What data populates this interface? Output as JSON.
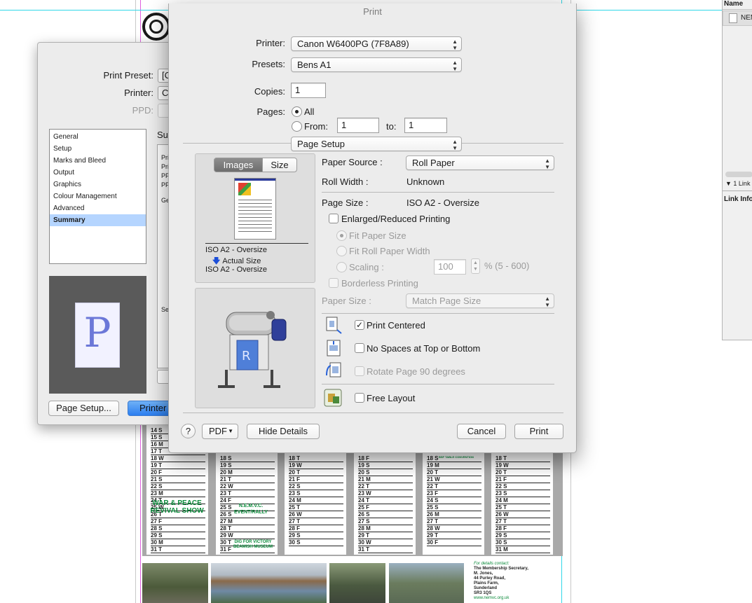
{
  "links_panel": {
    "name_header": "Name",
    "file_row": "NEM",
    "link_count": "1 Link",
    "link_info": "Link Info"
  },
  "calendar": {
    "columns": [
      [
        "14 S",
        "15 S",
        "16 M",
        "17 T",
        "18 W",
        "19 T",
        "20 F",
        "21 S",
        "22 S",
        "23 M",
        "24 T",
        "25 W",
        "26 T",
        "27 F",
        "28 S",
        "29 S",
        "30 M",
        "31 T"
      ],
      [
        "",
        "",
        "",
        "",
        "18 S",
        "19 S",
        "20 M",
        "21 T",
        "22 W",
        "23 T",
        "24 F",
        "25 S",
        "26 S",
        "27 M",
        "28 T",
        "29 W",
        "30 T",
        "31 F"
      ],
      [
        "",
        "",
        "",
        "",
        "18 T",
        "19 W",
        "20 T",
        "21 F",
        "22 S",
        "23 S",
        "24 M",
        "25 T",
        "26 W",
        "27 T",
        "28 F",
        "29 S",
        "30 S",
        ""
      ],
      [
        "",
        "",
        "",
        "",
        "18 F",
        "19 S",
        "20 S",
        "21 M",
        "22 T",
        "23 W",
        "24 T",
        "25 F",
        "26 S",
        "27 S",
        "28 M",
        "29 T",
        "30 W",
        "31 T"
      ],
      [
        "",
        "",
        "",
        "",
        "18 S",
        "19 M",
        "20 T",
        "21 W",
        "22 T",
        "23 F",
        "24 S",
        "25 S",
        "26 M",
        "27 T",
        "28 W",
        "29 T",
        "30 F",
        ""
      ],
      [
        "",
        "",
        "",
        "",
        "18 T",
        "19 W",
        "20 T",
        "21 F",
        "22 S",
        "23 S",
        "24 M",
        "25 T",
        "26 W",
        "27 T",
        "28 F",
        "29 S",
        "30 S",
        "31 M"
      ]
    ],
    "events": {
      "war_peace": "WAR & PEACE REVIVAL SHOW",
      "nemvc": "N.E.M.V.C. EVENT/RALLY",
      "dig": "DIG FOR VICTORY BEAMISH MUSEUM",
      "convention": "BSF TABLE CONVENTION"
    },
    "contact": {
      "heading": "For details contact:",
      "lines": [
        "The Membership Secretary,",
        "M. Jones,",
        "44 Purley Road,",
        "Plains Farm,",
        "Sunderland",
        "SR3 1QS"
      ],
      "web": "www.nemvc.org.uk"
    }
  },
  "indesign_print": {
    "print_preset_label": "Print Preset:",
    "print_preset_value": "[C",
    "printer_label": "Printer:",
    "printer_value": "C",
    "ppd_label": "PPD:",
    "categories": [
      "General",
      "Setup",
      "Marks and Bleed",
      "Output",
      "Graphics",
      "Colour Management",
      "Advanced",
      "Summary"
    ],
    "selected_category": "Summary",
    "summary_heading": "Su",
    "summary_lines": [
      "Pri",
      "Pri",
      "PP",
      "PP"
    ],
    "ge_label": "Ge",
    "se_label": "Se",
    "preview_letter": "P",
    "page_setup_button": "Page Setup...",
    "printer_button": "Printer"
  },
  "print_dialog": {
    "title": "Print",
    "printer_label": "Printer:",
    "printer_value": "Canon W6400PG (7F8A89)",
    "presets_label": "Presets:",
    "presets_value": "Bens A1",
    "copies_label": "Copies:",
    "copies_value": "1",
    "pages_label": "Pages:",
    "pages_all": "All",
    "pages_from": "From:",
    "pages_from_value": "1",
    "pages_to": "to:",
    "pages_to_value": "1",
    "pages_mode": "All",
    "section_value": "Page Setup",
    "preview_tabs": [
      "Images",
      "Size"
    ],
    "preview_active_tab": "Images",
    "preview_size_from": "ISO A2 - Oversize",
    "preview_mode": "Actual Size",
    "preview_size_to": "ISO A2 - Oversize",
    "paper_source_label": "Paper Source :",
    "paper_source_value": "Roll Paper",
    "roll_width_label": "Roll Width :",
    "roll_width_value": "Unknown",
    "page_size_label": "Page Size :",
    "page_size_value": "ISO A2 - Oversize",
    "enlarged_label": "Enlarged/Reduced Printing",
    "enlarged_checked": false,
    "fit_paper_label": "Fit Paper Size",
    "fit_roll_label": "Fit Roll Paper Width",
    "scaling_label": "Scaling :",
    "scaling_value": "100",
    "scaling_range": "% (5 - 600)",
    "borderless_label": "Borderless Printing",
    "paper_size_label": "Paper Size :",
    "paper_size_value": "Match Page Size",
    "print_centered_label": "Print Centered",
    "print_centered_checked": true,
    "no_spaces_label": "No Spaces at Top or Bottom",
    "rotate_label": "Rotate Page 90 degrees",
    "free_layout_label": "Free Layout",
    "help_label": "?",
    "pdf_label": "PDF",
    "hide_details_label": "Hide Details",
    "cancel_label": "Cancel",
    "print_label": "Print"
  }
}
